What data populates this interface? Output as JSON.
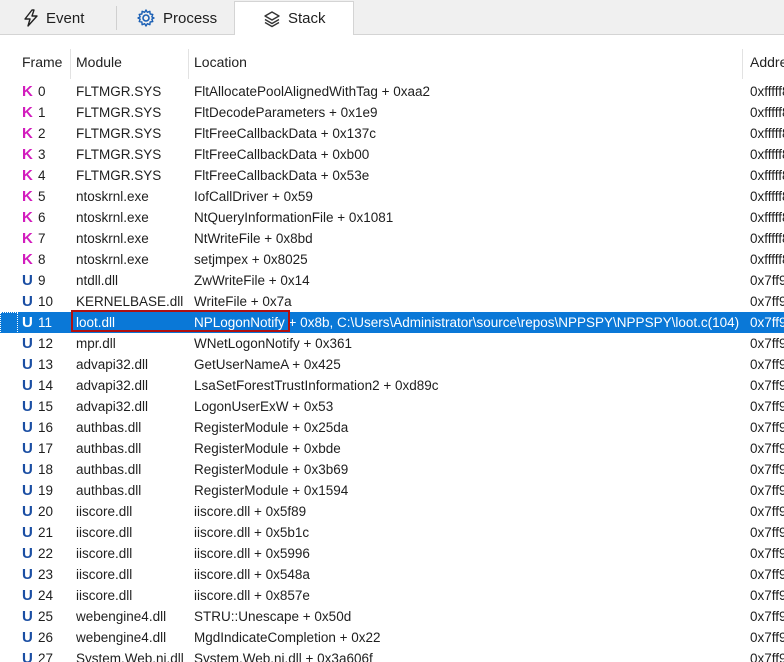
{
  "tabs": [
    {
      "label": "Event",
      "icon": "lightning-icon"
    },
    {
      "label": "Process",
      "icon": "gear-icon"
    },
    {
      "label": "Stack",
      "icon": "layers-icon"
    }
  ],
  "active_tab": "Stack",
  "columns": {
    "frame": "Frame",
    "module": "Module",
    "location": "Location",
    "address": "Addre"
  },
  "colors": {
    "kernel_icon": "#d21cbd",
    "user_icon": "#1a4ea3",
    "selection": "#0a78d7",
    "highlight_box": "#b01010"
  },
  "selected_frame": 11,
  "rows": [
    {
      "type": "K",
      "frame": "0",
      "module": "FLTMGR.SYS",
      "location": "FltAllocatePoolAlignedWithTag + 0xaa2",
      "address": "0xfffff8"
    },
    {
      "type": "K",
      "frame": "1",
      "module": "FLTMGR.SYS",
      "location": "FltDecodeParameters + 0x1e9",
      "address": "0xfffff8"
    },
    {
      "type": "K",
      "frame": "2",
      "module": "FLTMGR.SYS",
      "location": "FltFreeCallbackData + 0x137c",
      "address": "0xfffff8"
    },
    {
      "type": "K",
      "frame": "3",
      "module": "FLTMGR.SYS",
      "location": "FltFreeCallbackData + 0xb00",
      "address": "0xfffff8"
    },
    {
      "type": "K",
      "frame": "4",
      "module": "FLTMGR.SYS",
      "location": "FltFreeCallbackData + 0x53e",
      "address": "0xfffff8"
    },
    {
      "type": "K",
      "frame": "5",
      "module": "ntoskrnl.exe",
      "location": "IofCallDriver + 0x59",
      "address": "0xfffff8"
    },
    {
      "type": "K",
      "frame": "6",
      "module": "ntoskrnl.exe",
      "location": "NtQueryInformationFile + 0x1081",
      "address": "0xfffff8"
    },
    {
      "type": "K",
      "frame": "7",
      "module": "ntoskrnl.exe",
      "location": "NtWriteFile + 0x8bd",
      "address": "0xfffff8"
    },
    {
      "type": "K",
      "frame": "8",
      "module": "ntoskrnl.exe",
      "location": "setjmpex + 0x8025",
      "address": "0xfffff8"
    },
    {
      "type": "U",
      "frame": "9",
      "module": "ntdll.dll",
      "location": "ZwWriteFile + 0x14",
      "address": "0x7ff9"
    },
    {
      "type": "U",
      "frame": "10",
      "module": "KERNELBASE.dll",
      "location": "WriteFile + 0x7a",
      "address": "0x7ff9"
    },
    {
      "type": "U",
      "frame": "11",
      "module": "loot.dll",
      "location": "NPLogonNotify + 0x8b, C:\\Users\\Administrator\\source\\repos\\NPPSPY\\NPPSPY\\loot.c(104)",
      "address": "0x7ff9"
    },
    {
      "type": "U",
      "frame": "12",
      "module": "mpr.dll",
      "location": "WNetLogonNotify + 0x361",
      "address": "0x7ff9"
    },
    {
      "type": "U",
      "frame": "13",
      "module": "advapi32.dll",
      "location": "GetUserNameA + 0x425",
      "address": "0x7ff9"
    },
    {
      "type": "U",
      "frame": "14",
      "module": "advapi32.dll",
      "location": "LsaSetForestTrustInformation2 + 0xd89c",
      "address": "0x7ff9"
    },
    {
      "type": "U",
      "frame": "15",
      "module": "advapi32.dll",
      "location": "LogonUserExW + 0x53",
      "address": "0x7ff9"
    },
    {
      "type": "U",
      "frame": "16",
      "module": "authbas.dll",
      "location": "RegisterModule + 0x25da",
      "address": "0x7ff9"
    },
    {
      "type": "U",
      "frame": "17",
      "module": "authbas.dll",
      "location": "RegisterModule + 0xbde",
      "address": "0x7ff9"
    },
    {
      "type": "U",
      "frame": "18",
      "module": "authbas.dll",
      "location": "RegisterModule + 0x3b69",
      "address": "0x7ff9"
    },
    {
      "type": "U",
      "frame": "19",
      "module": "authbas.dll",
      "location": "RegisterModule + 0x1594",
      "address": "0x7ff9"
    },
    {
      "type": "U",
      "frame": "20",
      "module": "iiscore.dll",
      "location": "iiscore.dll + 0x5f89",
      "address": "0x7ff9"
    },
    {
      "type": "U",
      "frame": "21",
      "module": "iiscore.dll",
      "location": "iiscore.dll + 0x5b1c",
      "address": "0x7ff9"
    },
    {
      "type": "U",
      "frame": "22",
      "module": "iiscore.dll",
      "location": "iiscore.dll + 0x5996",
      "address": "0x7ff9"
    },
    {
      "type": "U",
      "frame": "23",
      "module": "iiscore.dll",
      "location": "iiscore.dll + 0x548a",
      "address": "0x7ff9"
    },
    {
      "type": "U",
      "frame": "24",
      "module": "iiscore.dll",
      "location": "iiscore.dll + 0x857e",
      "address": "0x7ff9"
    },
    {
      "type": "U",
      "frame": "25",
      "module": "webengine4.dll",
      "location": "STRU::Unescape + 0x50d",
      "address": "0x7ff9"
    },
    {
      "type": "U",
      "frame": "26",
      "module": "webengine4.dll",
      "location": "MgdIndicateCompletion + 0x22",
      "address": "0x7ff9"
    },
    {
      "type": "U",
      "frame": "27",
      "module": "System.Web.ni.dll",
      "location": "System.Web.ni.dll + 0x3a606f",
      "address": "0x7ff9"
    }
  ]
}
